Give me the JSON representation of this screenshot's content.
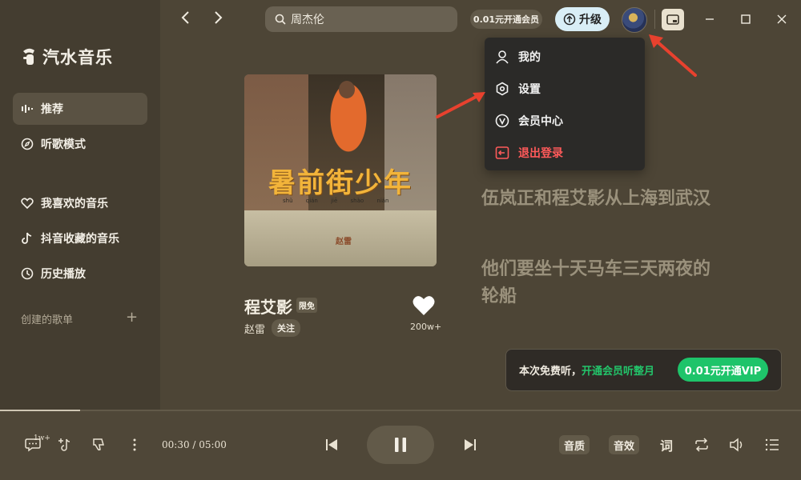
{
  "app": {
    "name": "汽水音乐"
  },
  "sidebar": {
    "items": [
      {
        "label": "推荐",
        "icon": "bars-icon",
        "active": true
      },
      {
        "label": "听歌模式",
        "icon": "compass-icon",
        "active": false
      },
      {
        "label": "我喜欢的音乐",
        "icon": "heart-icon",
        "active": false
      },
      {
        "label": "抖音收藏的音乐",
        "icon": "tiktok-icon",
        "active": false
      },
      {
        "label": "历史播放",
        "icon": "clock-icon",
        "active": false
      }
    ],
    "playlists_label": "创建的歌单",
    "add_label": "+"
  },
  "header": {
    "search_value": "周杰伦",
    "vip_trial": "0.01元开通会员",
    "upgrade_label": "升级"
  },
  "user_menu": {
    "items": [
      {
        "label": "我的",
        "icon": "user-icon"
      },
      {
        "label": "设置",
        "icon": "hexagon-settings-icon"
      },
      {
        "label": "会员中心",
        "icon": "vip-icon"
      },
      {
        "label": "退出登录",
        "icon": "logout-icon",
        "danger": true
      }
    ]
  },
  "album": {
    "cover_title": "暑前街少年",
    "cover_pinyin": "shǔ qián jiē shào nián",
    "cover_stamp": "赵雷"
  },
  "song": {
    "title": "程艾影",
    "badge": "限免",
    "artist": "赵雷",
    "follow_label": "关注",
    "like_count": "200w+"
  },
  "lyrics": [
    "伍岚正和程艾影从上海到武汉",
    "他们要坐十天马车三天两夜的轮船"
  ],
  "promo": {
    "text": "本次免费听，",
    "highlight": "开通会员听整月",
    "button": "0.01元开通VIP"
  },
  "player": {
    "comment_count": "1w+",
    "time": "00:30 / 05:00",
    "progress": 0.1,
    "quality_label": "音质",
    "effect_label": "音效",
    "lyrics_label": "词"
  },
  "colors": {
    "accent_green": "#1ec46a",
    "danger_red": "#ff5a5a",
    "upgrade_bg": "#d9eef6",
    "annotation_arrow": "#e8412e"
  }
}
